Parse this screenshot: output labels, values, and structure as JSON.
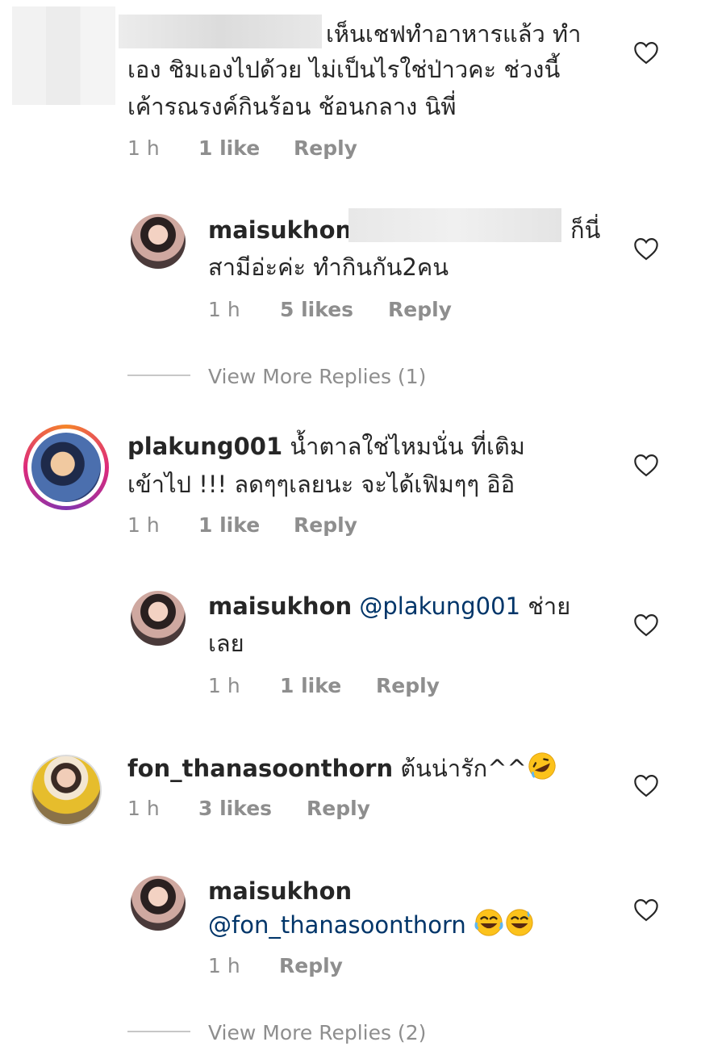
{
  "comments": [
    {
      "id": "c1",
      "username": "",
      "text_lines": [
        "เห็นเชฟทำอาหารแล้ว ทำ",
        "เอง ชิมเองไปด้วย ไม่เป็นไรใช่ป่าวคะ ช่วงนี้",
        "เค้ารณรงค์กินร้อน ช้อนกลาง นิพี่"
      ],
      "time": "1 h",
      "likes": "1 like",
      "reply": "Reply",
      "replies": [
        {
          "username": "maisukhon",
          "text_lines": [
            "ก็นี่",
            "สามีอ่ะค่ะ ทำกินกัน2คน"
          ],
          "time": "1 h",
          "likes": "5 likes",
          "reply": "Reply"
        }
      ],
      "view_more": "View More Replies (1)"
    },
    {
      "id": "c2",
      "username": "plakung001",
      "text_lines": [
        "น้ำตาลใช่ไหมนั่น ที่เติม",
        "เข้าไป !!! ลดๆๆเลยนะ จะได้เฟิมๆๆ อิอิ"
      ],
      "time": "1 h",
      "likes": "1 like",
      "reply": "Reply",
      "replies": [
        {
          "username": "maisukhon",
          "mention": "@plakung001",
          "text_lines": [
            "ช่าย",
            "เลย"
          ],
          "time": "1 h",
          "likes": "1 like",
          "reply": "Reply"
        }
      ]
    },
    {
      "id": "c3",
      "username": "fon_thanasoonthorn",
      "text_lines": [
        "ต้นน่ารัก^^"
      ],
      "time": "1 h",
      "likes": "3 likes",
      "reply": "Reply",
      "replies": [
        {
          "username": "maisukhon",
          "mention": "@fon_thanasoonthorn",
          "time": "1 h",
          "reply": "Reply"
        }
      ],
      "view_more": "View More Replies (2)"
    }
  ],
  "icons": {
    "like": "heart-outline-icon",
    "emoji_rofl": "rolling-on-floor-laughing-emoji",
    "emoji_joy": "tears-of-joy-emoji",
    "emoji_grin_sweat": "grinning-sweat-emoji"
  },
  "colors": {
    "text": "#262626",
    "meta": "#8e8e8e",
    "mention": "#003569",
    "story_ring": "#e1306c"
  }
}
